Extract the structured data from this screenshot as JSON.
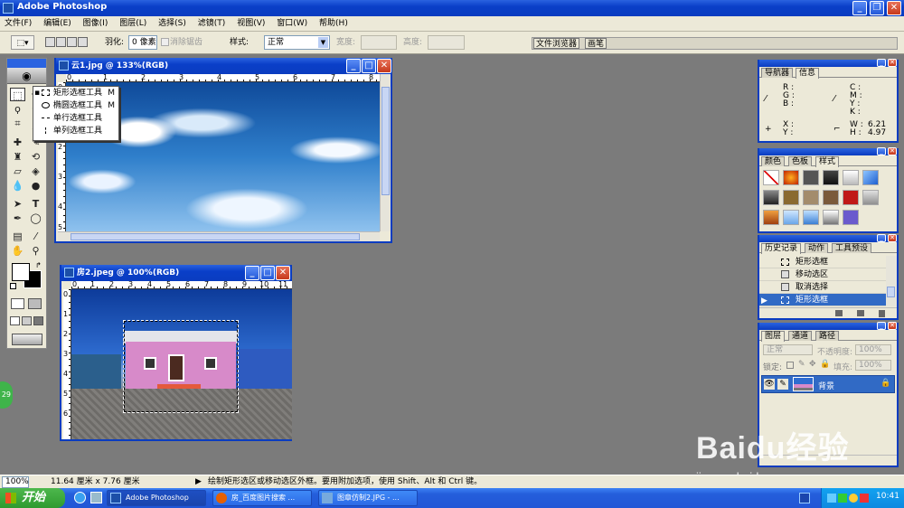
{
  "app": {
    "title": "Adobe Photoshop"
  },
  "menu": [
    "文件(F)",
    "编辑(E)",
    "图像(I)",
    "图层(L)",
    "选择(S)",
    "滤镜(T)",
    "视图(V)",
    "窗口(W)",
    "帮助(H)"
  ],
  "options": {
    "feather_label": "羽化:",
    "feather_value": "0 像素",
    "antialias_label": "消除锯齿",
    "style_label": "样式:",
    "style_value": "正常",
    "width_label": "宽度:",
    "height_label": "高度:",
    "tab_browser": "文件浏览器",
    "tab_brushes": "画笔"
  },
  "flyout": [
    {
      "label": "矩形选框工具",
      "key": "M"
    },
    {
      "label": "椭圆选框工具",
      "key": "M"
    },
    {
      "label": "单行选框工具",
      "key": ""
    },
    {
      "label": "单列选框工具",
      "key": ""
    }
  ],
  "doc1": {
    "title": "云1.jpg @ 133%(RGB)",
    "ruler_h": [
      "0",
      "1",
      "2",
      "3",
      "4",
      "5",
      "6",
      "7",
      "8"
    ],
    "ruler_v": [
      "0",
      "1",
      "2",
      "3",
      "4",
      "5"
    ]
  },
  "doc2": {
    "title": "房2.jpeg @ 100%(RGB)",
    "ruler_h": [
      "0",
      "1",
      "2",
      "3",
      "4",
      "5",
      "6",
      "7",
      "8",
      "9",
      "10",
      "11"
    ],
    "ruler_v": [
      "0",
      "1",
      "2",
      "3",
      "4",
      "5",
      "6"
    ]
  },
  "navigator": {
    "tab_nav": "导航器",
    "tab_info": "信息",
    "rgb": [
      "R :",
      "G :",
      "B :"
    ],
    "cmyk": [
      "C :",
      "M :",
      "Y :",
      "K :"
    ],
    "xy": [
      "X :",
      "Y :"
    ],
    "w_label": "W :",
    "w_value": "6.21",
    "h_label": "H :",
    "h_value": "4.97"
  },
  "styles_panel": {
    "tab_color": "颜色",
    "tab_swatches": "色板",
    "tab_styles": "样式"
  },
  "history": {
    "tab_history": "历史记录",
    "tab_actions": "动作",
    "tab_presets": "工具预设",
    "items": [
      "矩形选框",
      "移动选区",
      "取消选择",
      "矩形选框"
    ]
  },
  "layers": {
    "tab_layers": "图层",
    "tab_channels": "通道",
    "tab_paths": "路径",
    "blend": "正常",
    "opacity_label": "不透明度:",
    "opacity_value": "100%",
    "lock_label": "锁定:",
    "fill_label": "填充:",
    "fill_value": "100%",
    "layer_name": "背景"
  },
  "status": {
    "zoom": "100%",
    "size": "11.64 厘米 x 7.76 厘米",
    "hint": "绘制矩形选区或移动选区外框。要用附加选项，使用 Shift、Alt 和 Ctrl 键。"
  },
  "taskbar": {
    "start": "开始",
    "tasks": [
      "Adobe Photoshop",
      "房_百度图片搜索 ...",
      "图章仿制2.JPG - ..."
    ],
    "clock": "10:41"
  },
  "watermark": {
    "brand": "Baidu经验",
    "url": "jingyan.baidu.com"
  },
  "badge": "29"
}
